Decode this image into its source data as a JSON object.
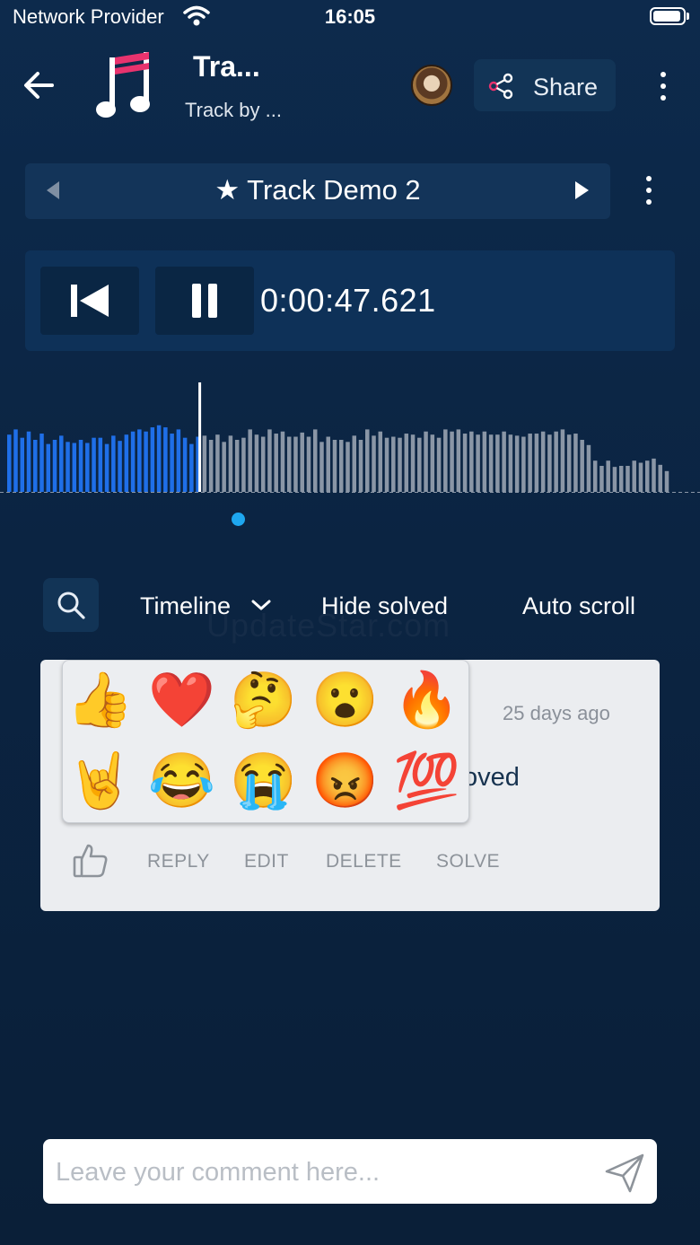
{
  "status_bar": {
    "carrier": "Network Provider",
    "time": "16:05"
  },
  "header": {
    "title": "Tra...",
    "subtitle": "Track by ...",
    "share_label": "Share"
  },
  "track_selector": {
    "name": "★ Track Demo 2"
  },
  "player": {
    "position": "0:00:47.621",
    "progress": 0.29
  },
  "waveform": {
    "amplitudes": [
      0.55,
      0.6,
      0.52,
      0.58,
      0.5,
      0.56,
      0.46,
      0.5,
      0.54,
      0.48,
      0.47,
      0.5,
      0.47,
      0.52,
      0.52,
      0.46,
      0.54,
      0.49,
      0.55,
      0.58,
      0.6,
      0.58,
      0.62,
      0.64,
      0.62,
      0.56,
      0.6,
      0.52,
      0.46,
      0.53,
      0.54,
      0.5,
      0.55,
      0.48,
      0.54,
      0.5,
      0.52,
      0.6,
      0.55,
      0.53,
      0.6,
      0.56,
      0.58,
      0.53,
      0.53,
      0.57,
      0.53,
      0.6,
      0.48,
      0.53,
      0.5,
      0.5,
      0.48,
      0.54,
      0.5,
      0.6,
      0.54,
      0.58,
      0.52,
      0.53,
      0.52,
      0.56,
      0.55,
      0.52,
      0.58,
      0.55,
      0.52,
      0.6,
      0.58,
      0.6,
      0.56,
      0.58,
      0.55,
      0.58,
      0.55,
      0.55,
      0.58,
      0.55,
      0.54,
      0.53,
      0.56,
      0.56,
      0.58,
      0.55,
      0.58,
      0.6,
      0.55,
      0.56,
      0.5,
      0.45,
      0.3,
      0.25,
      0.3,
      0.24,
      0.25,
      0.25,
      0.3,
      0.28,
      0.3,
      0.32,
      0.26,
      0.2
    ],
    "played_color": "#1f6fe8",
    "unplayed_color": "#8a96a6",
    "playhead_color": "#ffffff"
  },
  "filters": {
    "timeline": "Timeline",
    "hide_solved": "Hide solved",
    "auto_scroll": "Auto scroll"
  },
  "watermark": "UpdateStar.com",
  "comment": {
    "time_ago": "25 days ago",
    "text_visible": "oved",
    "actions": {
      "reply": "REPLY",
      "edit": "EDIT",
      "delete": "DELETE",
      "solve": "SOLVE"
    }
  },
  "reactions": [
    {
      "name": "thumbs-up-emoji",
      "glyph": "👍"
    },
    {
      "name": "red-heart-emoji",
      "glyph": "❤️"
    },
    {
      "name": "thinking-face-emoji",
      "glyph": "🤔"
    },
    {
      "name": "surprised-face-emoji",
      "glyph": "😮"
    },
    {
      "name": "fire-emoji",
      "glyph": "🔥"
    },
    {
      "name": "rock-on-emoji",
      "glyph": "🤘"
    },
    {
      "name": "tears-of-joy-emoji",
      "glyph": "😂"
    },
    {
      "name": "crying-face-emoji",
      "glyph": "😭"
    },
    {
      "name": "angry-face-emoji",
      "glyph": "😡"
    },
    {
      "name": "hundred-points-emoji",
      "glyph": "💯"
    }
  ],
  "comment_input": {
    "placeholder": "Leave your comment here..."
  }
}
